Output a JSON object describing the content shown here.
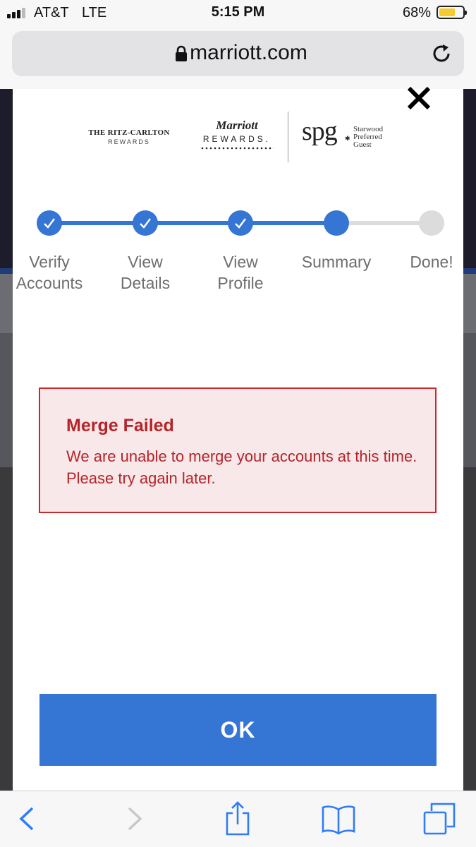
{
  "status_bar": {
    "carrier": "AT&T",
    "network": "LTE",
    "time": "5:15 PM",
    "battery_percent_text": "68%",
    "battery_level": 0.68,
    "battery_color": "#f6cb2f"
  },
  "browser": {
    "url": "marriott.com",
    "lock_icon": "lock-icon",
    "reload_icon": "reload-icon"
  },
  "modal": {
    "close_icon": "close-icon",
    "brands": {
      "ritz_title": "THE RITZ-CARLTON",
      "ritz_sub": "REWARDS",
      "marriott_title": "Marriott",
      "marriott_sub": "REWARDS.",
      "spg_name": "spg",
      "spg_sub_1": "Starwood",
      "spg_sub_2": "Preferred",
      "spg_sub_3": "Guest"
    },
    "stepper": {
      "steps": [
        {
          "label_1": "Verify",
          "label_2": "Accounts",
          "state": "complete"
        },
        {
          "label_1": "View",
          "label_2": "Details",
          "state": "complete"
        },
        {
          "label_1": "View",
          "label_2": "Profile",
          "state": "complete"
        },
        {
          "label_1": "Summary",
          "label_2": "",
          "state": "current"
        },
        {
          "label_1": "Done!",
          "label_2": "",
          "state": "pending"
        }
      ],
      "accent_color": "#3575d3",
      "pending_color": "#dcdcdc"
    },
    "error": {
      "title": "Merge Failed",
      "message": "We are unable to merge your accounts at this time. Please try again later.",
      "color": "#b52428",
      "background": "#f8e8ea"
    },
    "ok_label": "OK"
  },
  "toolbar": {
    "back_icon": "back-icon",
    "forward_icon": "forward-icon",
    "share_icon": "share-icon",
    "bookmarks_icon": "bookmarks-icon",
    "tabs_icon": "tabs-icon"
  }
}
